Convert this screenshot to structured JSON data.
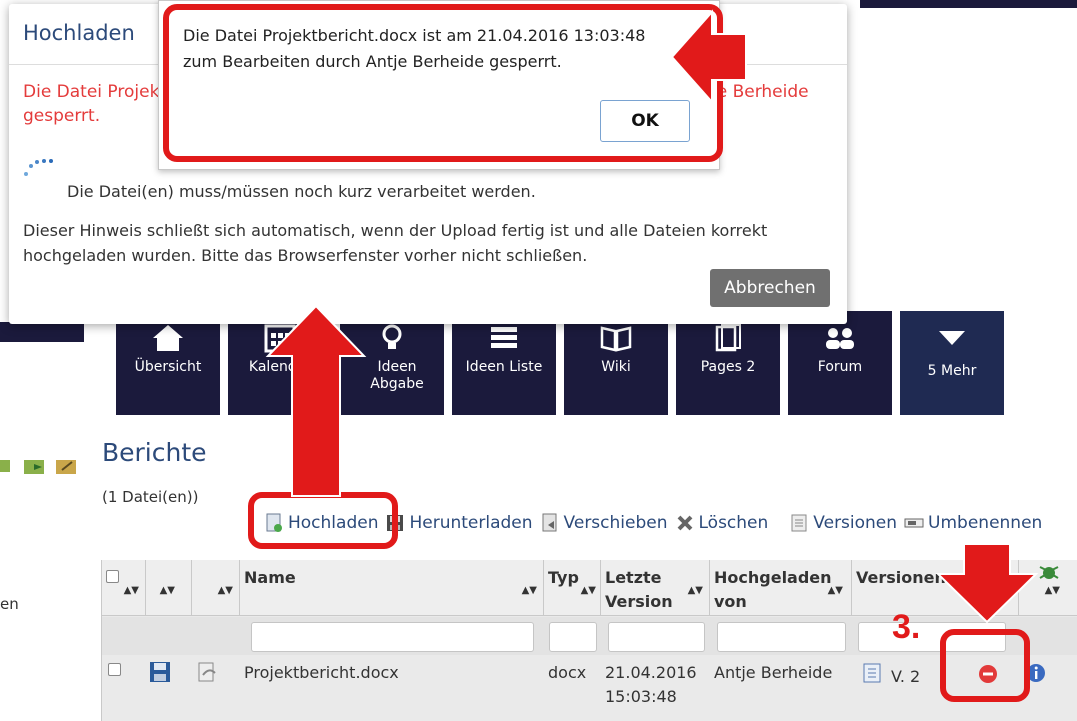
{
  "nav_tiles": [
    {
      "label": "Übersicht"
    },
    {
      "label": "Kalender"
    },
    {
      "label": "Ideen Abgabe"
    },
    {
      "label": "Ideen Liste"
    },
    {
      "label": "Wiki"
    },
    {
      "label": "Pages 2"
    },
    {
      "label": "Forum"
    },
    {
      "label": "5 Mehr"
    }
  ],
  "sidebar_text": "en",
  "page": {
    "title": "Berichte",
    "file_count": "(1 Datei(en))"
  },
  "toolbar": {
    "upload": "Hochladen",
    "download": "Herunterladen",
    "move": "Verschieben",
    "delete": "Löschen",
    "versions": "Versionen",
    "rename": "Umbenennen"
  },
  "table": {
    "headers": {
      "name": "Name",
      "type": "Typ",
      "last_version": "Letzte Version",
      "uploaded_by": "Hochgeladen von",
      "versions": "Versionen"
    },
    "row": {
      "name": "Projektbericht.docx",
      "type": "docx",
      "date": "21.04.2016",
      "time": "15:03:48",
      "uploaded_by": "Antje Berheide",
      "version": "V. 2"
    }
  },
  "dialog": {
    "title": "Hochladen",
    "error_left": "Die Datei Projek",
    "error_right": "je Berheide",
    "error_line2": "gesperrt.",
    "wait_text": "Die Datei(en) muss/müssen noch kurz verarbeitet werden.",
    "hint_text": "Dieser Hinweis schließt sich automatisch, wenn der Upload fertig ist und alle Dateien korrekt hochgeladen wurden. Bitte das Browserfenster vorher nicht schließen.",
    "cancel_label": "Abbrechen"
  },
  "alert": {
    "line1": "Die Datei Projektbericht.docx ist am 21.04.2016 13:03:48",
    "line2": "zum Bearbeiten durch Antje Berheide gesperrt.",
    "ok_label": "OK"
  },
  "annotation": {
    "step_number": "3."
  },
  "colors": {
    "nav_bg": "#1b1a3c",
    "accent_blue": "#2c4a7a",
    "error_red": "#e43b3b",
    "annotation_red": "#e11a1a"
  }
}
